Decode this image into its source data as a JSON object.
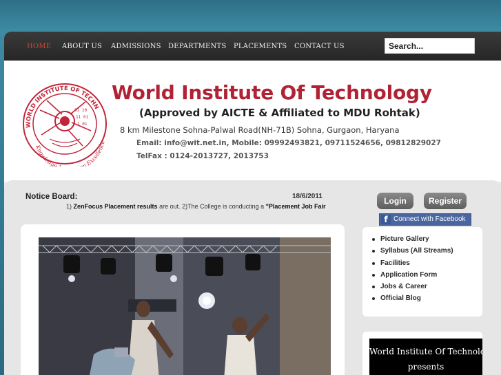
{
  "nav": {
    "items": [
      "HOME",
      "ABOUT US",
      "ADMISSIONS",
      "DEPARTMENTS",
      "PLACEMENTS",
      "CONTACT US"
    ],
    "active_color": "#d8452d"
  },
  "search": {
    "value": "Search..."
  },
  "header": {
    "title": "World Institute Of Technology",
    "approved": "(Approved by AICTE & Affiliated to MDU Rohtak)",
    "address": "8 km Milestone  Sohna-Palwal Road(NH-71B) Sohna, Gurgaon, Haryana",
    "contact": "Email: info@wit.net.in, Mobile: 09992493821, 09711524656, 09812829027",
    "telfax": "TelFax : 0124-2013727, 2013753",
    "title_color": "#b12235"
  },
  "logo": {
    "ring_text": "WORLD INSTITUTE OF TECHNOLOGY",
    "motto": "Knowledge Innovation Excellence",
    "color": "#c2243a"
  },
  "notice": {
    "label": "Notice Board:",
    "date": "18/6/2011",
    "ticker_prefix": "1) ",
    "ticker_bold1": "ZenFocus Placement results",
    "ticker_mid": " are out. 2)The College is conducting a ",
    "ticker_bold2": "\"Placement Job Fair"
  },
  "auth": {
    "login": "Login",
    "register": "Register"
  },
  "facebook": {
    "label": "Connect with Facebook",
    "icon": "facebook-f-icon"
  },
  "quick_links": [
    "Picture Gallery",
    "Syllabus (All Streams)",
    "Facilities",
    "Application Form",
    "Jobs & Career",
    "Official Blog"
  ],
  "promo": {
    "line1": "World Institute Of Technology",
    "line2": "presents"
  }
}
